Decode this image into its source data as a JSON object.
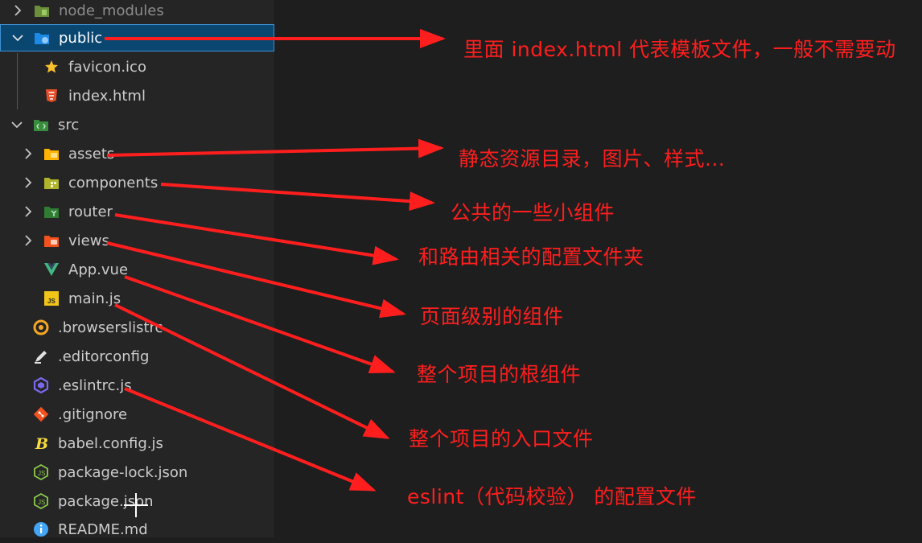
{
  "explorer": {
    "items": [
      {
        "label": "node_modules",
        "kind": "folder",
        "expanded": false,
        "icon": "folder-node-icon",
        "color": "#8bc34a"
      },
      {
        "label": "public",
        "kind": "folder",
        "expanded": true,
        "selected": true,
        "icon": "folder-public-icon",
        "color": "#42a5f5"
      },
      {
        "label": "favicon.ico",
        "kind": "file",
        "icon": "star-icon",
        "color": "#fbc02d"
      },
      {
        "label": "index.html",
        "kind": "file",
        "icon": "html5-icon",
        "color": "#e44d26"
      },
      {
        "label": "src",
        "kind": "folder",
        "expanded": true,
        "icon": "folder-src-icon",
        "color": "#4caf50"
      },
      {
        "label": "assets",
        "kind": "folder",
        "expanded": false,
        "icon": "folder-assets-icon",
        "color": "#ffca28"
      },
      {
        "label": "components",
        "kind": "folder",
        "expanded": false,
        "icon": "folder-components-icon",
        "color": "#c0ca33"
      },
      {
        "label": "router",
        "kind": "folder",
        "expanded": false,
        "icon": "folder-router-icon",
        "color": "#43a047"
      },
      {
        "label": "views",
        "kind": "folder",
        "expanded": false,
        "icon": "folder-views-icon",
        "color": "#ff7043"
      },
      {
        "label": "App.vue",
        "kind": "file",
        "icon": "vue-icon",
        "color": "#41b883"
      },
      {
        "label": "main.js",
        "kind": "file",
        "icon": "js-icon",
        "color": "#f0c419"
      },
      {
        "label": ".browserslistrc",
        "kind": "file",
        "icon": "browserslist-icon",
        "color": "#f5a623"
      },
      {
        "label": ".editorconfig",
        "kind": "file",
        "icon": "editorconfig-icon",
        "color": "#e0e0e0"
      },
      {
        "label": ".eslintrc.js",
        "kind": "file",
        "icon": "eslint-icon",
        "color": "#7b68ee"
      },
      {
        "label": ".gitignore",
        "kind": "file",
        "icon": "git-icon",
        "color": "#f4511e"
      },
      {
        "label": "babel.config.js",
        "kind": "file",
        "icon": "babel-icon",
        "color": "#f9dc3e"
      },
      {
        "label": "package-lock.json",
        "kind": "file",
        "icon": "nodejs-icon",
        "color": "#8cc84b"
      },
      {
        "label": "package.json",
        "kind": "file",
        "icon": "nodejs-icon",
        "color": "#8cc84b"
      },
      {
        "label": "README.md",
        "kind": "file",
        "icon": "info-icon",
        "color": "#42a5f5"
      }
    ]
  },
  "annotations": [
    {
      "target": "public",
      "text": "里面 index.html 代表模板文件，一般不需要动"
    },
    {
      "target": "assets",
      "text": "静态资源目录，图片、样式..."
    },
    {
      "target": "components",
      "text": "公共的一些小组件"
    },
    {
      "target": "router",
      "text": "和路由相关的配置文件夹"
    },
    {
      "target": "views",
      "text": "页面级别的组件"
    },
    {
      "target": "App.vue",
      "text": "整个项目的根组件"
    },
    {
      "target": "main.js",
      "text": "整个项目的入口文件"
    },
    {
      "target": ".eslintrc.js",
      "text": "eslint（代码校验） 的配置文件"
    }
  ],
  "colors": {
    "annotation": "#ff1e1e",
    "selection": "#094771",
    "selection_border": "#3f8fd2",
    "sidebar_bg": "#252526",
    "editor_bg": "#1e1e1e"
  }
}
